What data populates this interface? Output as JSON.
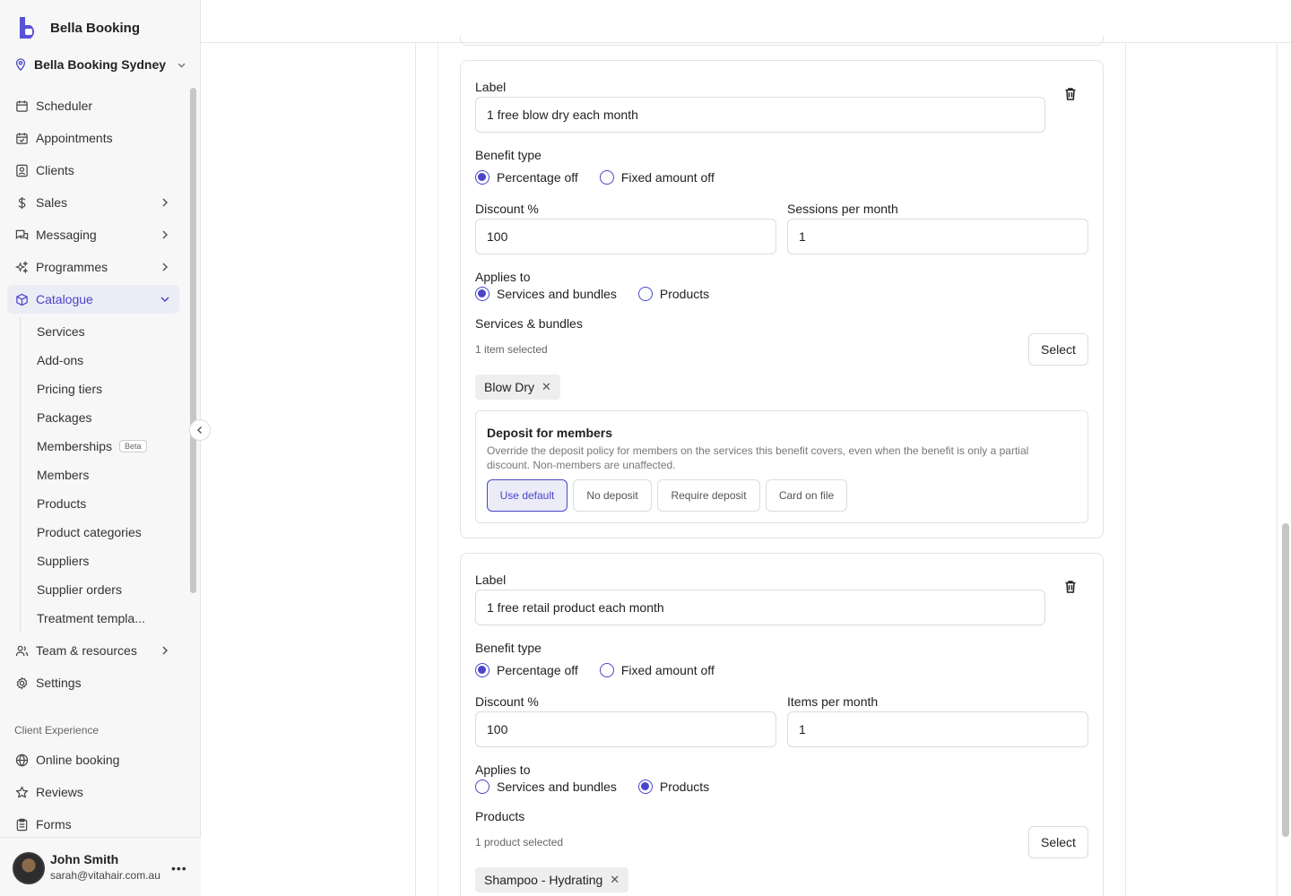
{
  "app": {
    "name": "Bella Booking",
    "location": "Bella Booking Sydney"
  },
  "sidebar": {
    "items": [
      {
        "label": "Scheduler",
        "icon": "calendar-icon"
      },
      {
        "label": "Appointments",
        "icon": "calendar-check-icon"
      },
      {
        "label": "Clients",
        "icon": "contact-icon"
      },
      {
        "label": "Sales",
        "icon": "dollar-icon"
      },
      {
        "label": "Messaging",
        "icon": "messages-icon"
      },
      {
        "label": "Programmes",
        "icon": "sparkles-icon"
      },
      {
        "label": "Catalogue",
        "icon": "box-icon"
      }
    ],
    "catalogue_sub": [
      "Services",
      "Add-ons",
      "Pricing tiers",
      "Packages",
      "Memberships",
      "Members",
      "Products",
      "Product categories",
      "Suppliers",
      "Supplier orders",
      "Treatment templa..."
    ],
    "beta_badge": "Beta",
    "items_after": [
      {
        "label": "Team & resources",
        "icon": "users-icon"
      },
      {
        "label": "Settings",
        "icon": "gear-icon"
      }
    ],
    "section_label": "Client Experience",
    "client_items": [
      {
        "label": "Online booking",
        "icon": "globe-icon"
      },
      {
        "label": "Reviews",
        "icon": "star-icon"
      },
      {
        "label": "Forms",
        "icon": "clipboard-icon"
      }
    ]
  },
  "user": {
    "name": "John Smith",
    "email": "sarah@vitahair.com.au",
    "more": "•••"
  },
  "benefits": [
    {
      "label_title": "Label",
      "label_value": "1 free blow dry each month",
      "benefit_type_title": "Benefit type",
      "benefit_options": [
        "Percentage off",
        "Fixed amount off"
      ],
      "benefit_selected": "Percentage off",
      "discount_title": "Discount %",
      "discount_value": "100",
      "qty_title": "Sessions per month",
      "qty_value": "1",
      "applies_title": "Applies to",
      "applies_options": [
        "Services and bundles",
        "Products"
      ],
      "applies_selected": "Services and bundles",
      "selection_title": "Services & bundles",
      "selection_count": "1 item selected",
      "select_label": "Select",
      "chip": "Blow Dry",
      "deposit": {
        "title": "Deposit for members",
        "description": "Override the deposit policy for members on the services this benefit covers, even when the benefit is only a partial discount. Non-members are unaffected.",
        "options": [
          "Use default",
          "No deposit",
          "Require deposit",
          "Card on file"
        ],
        "selected": "Use default"
      }
    },
    {
      "label_title": "Label",
      "label_value": "1 free retail product each month",
      "benefit_type_title": "Benefit type",
      "benefit_options": [
        "Percentage off",
        "Fixed amount off"
      ],
      "benefit_selected": "Percentage off",
      "discount_title": "Discount %",
      "discount_value": "100",
      "qty_title": "Items per month",
      "qty_value": "1",
      "applies_title": "Applies to",
      "applies_options": [
        "Services and bundles",
        "Products"
      ],
      "applies_selected": "Products",
      "selection_title": "Products",
      "selection_count": "1 product selected",
      "select_label": "Select",
      "chip": "Shampoo - Hydrating"
    }
  ],
  "colors": {
    "accent": "#4a45c9",
    "active_bg": "#ececf6"
  }
}
